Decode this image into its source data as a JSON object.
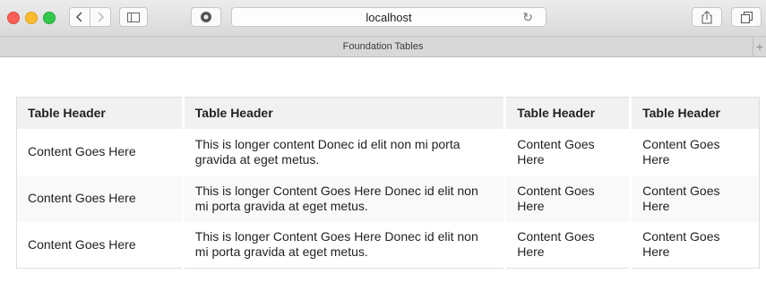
{
  "browser": {
    "address": "localhost",
    "tab_title": "Foundation Tables",
    "icons": {
      "back": "chevron-left-icon",
      "forward": "chevron-right-icon",
      "sidebar": "sidebar-icon",
      "extension": "extension-icon",
      "reload": "reload-icon",
      "share": "share-icon",
      "tabs": "tabs-overview-icon",
      "new_tab": "plus-icon"
    }
  },
  "table": {
    "headers": [
      "Table Header",
      "Table Header",
      "Table Header",
      "Table Header"
    ],
    "rows": [
      [
        "Content Goes Here",
        "This is longer content Donec id elit non mi porta gravida at eget metus.",
        "Content Goes Here",
        "Content Goes Here"
      ],
      [
        "Content Goes Here",
        "This is longer Content Goes Here Donec id elit non mi porta gravida at eget metus.",
        "Content Goes Here",
        "Content Goes Here"
      ],
      [
        "Content Goes Here",
        "This is longer Content Goes Here Donec id elit non mi porta gravida at eget metus.",
        "Content Goes Here",
        "Content Goes Here"
      ]
    ]
  }
}
